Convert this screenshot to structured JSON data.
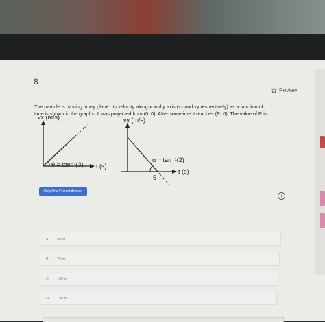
{
  "question": {
    "number": "8",
    "review_label": "Review",
    "text_line1": "The particle is moving in x-y plane. Its velocity along x and y axis (vx and vy respectively) as a function of",
    "text_line2": "time is shown in the graphs. It was projected from (0, 0). After sometime it reaches (R, 0). The value of R is"
  },
  "graph_left": {
    "y_label": "vx (m/s)",
    "x_label": "t (s)",
    "angle_label": "θ = tan⁻¹(3)"
  },
  "graph_right": {
    "y_label": "vy (m/s)",
    "x_label": "t (s)",
    "angle_label": "α = tan⁻¹(2)",
    "intercept_label": "5"
  },
  "answer_type_badge": "Only One Correct Answer",
  "options": [
    {
      "letter": "A.",
      "value": "50 m"
    },
    {
      "letter": "B.",
      "value": "75 m"
    },
    {
      "letter": "C.",
      "value": "100 m"
    },
    {
      "letter": "D.",
      "value": "150 m"
    }
  ],
  "colors": {
    "accent": "#3c6fd2",
    "side_tab_red": "#c44a4a",
    "side_tab_pink": "#d98aa8"
  },
  "icons": {
    "review": "star-outline-icon",
    "info": "info-circle-icon"
  }
}
